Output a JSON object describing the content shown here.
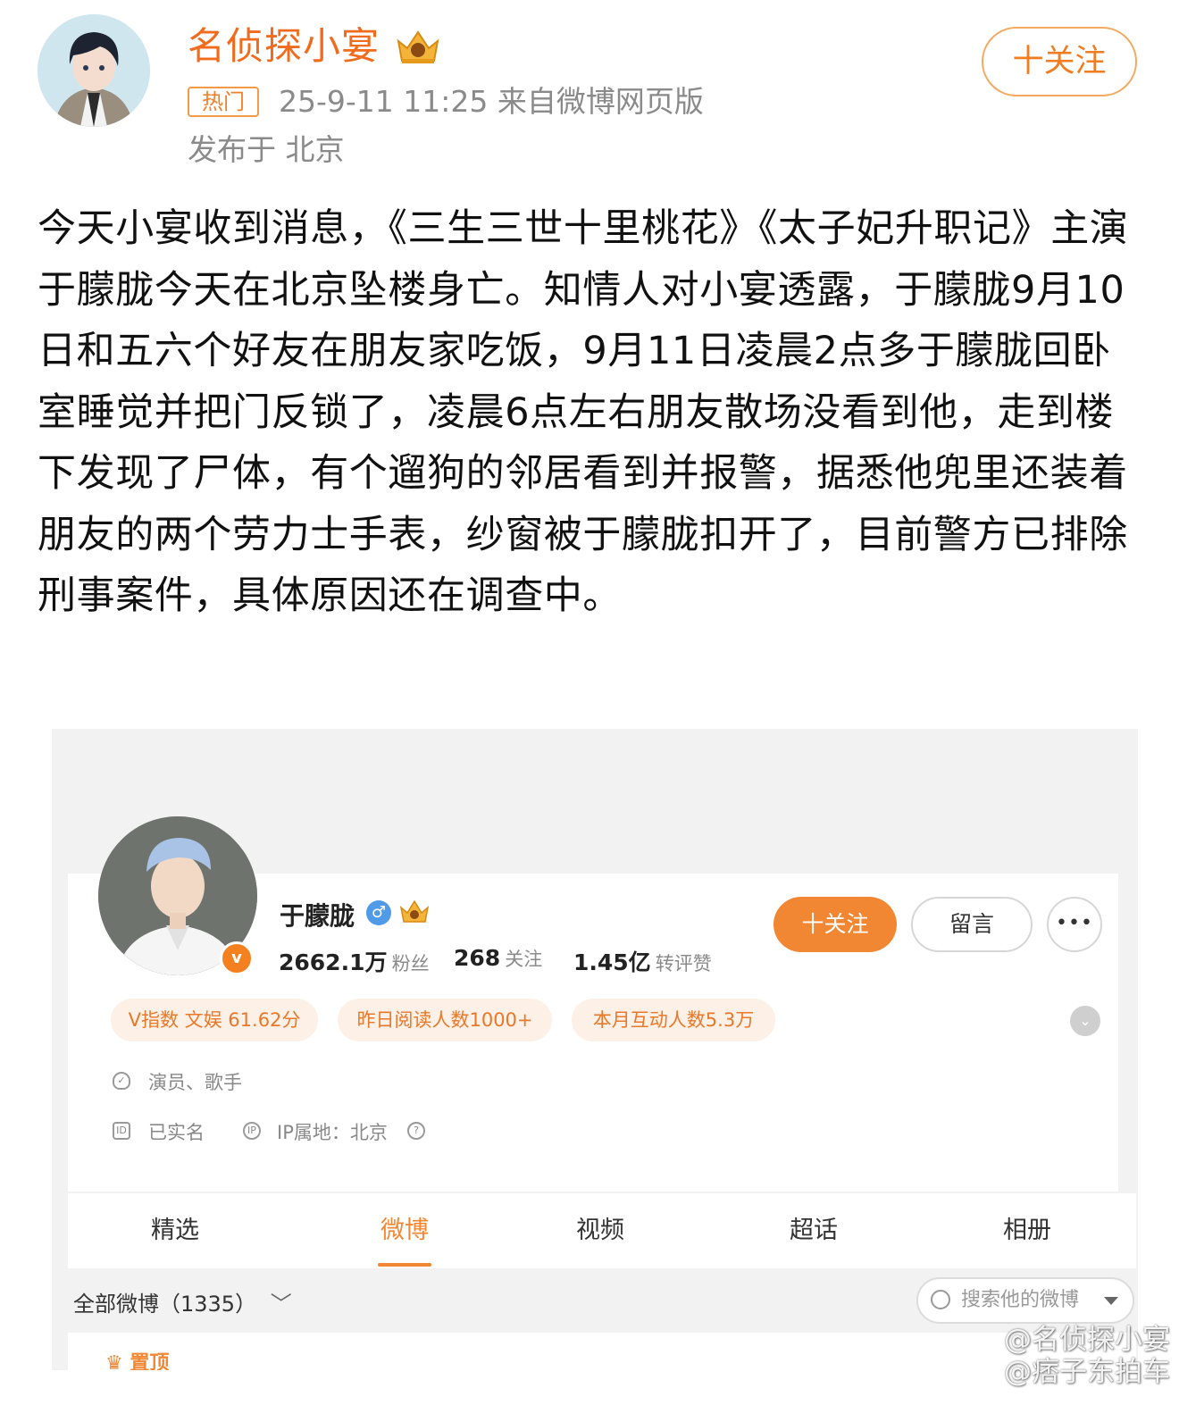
{
  "post": {
    "author": "名侦探小宴",
    "hot_tag": "热门",
    "meta": "25-9-11 11:25  来自微博网页版",
    "location": "发布于 北京",
    "follow_label": "十关注",
    "text": "今天小宴收到消息，《三生三世十里桃花》《太子妃升职记》主演于朦胧今天在北京坠楼身亡。知情人对小宴透露，于朦胧9月10日和五六个好友在朋友家吃饭，9月11日凌晨2点多于朦胧回卧室睡觉并把门反锁了，凌晨6点左右朋友散场没看到他，走到楼下发现了尸体，有个遛狗的邻居看到并报警，据悉他兜里还装着朋友的两个劳力士手表，纱窗被于朦胧扣开了，目前警方已排除刑事案件，具体原因还在调查中。"
  },
  "profile": {
    "name": "于朦胧",
    "gender_icon": "♂",
    "verified_badge": "v",
    "stats": [
      {
        "num": "2662.1万",
        "label": "粉丝"
      },
      {
        "num": "268",
        "label": "关注"
      },
      {
        "num": "1.45亿",
        "label": "转评赞"
      }
    ],
    "follow_label": "十关注",
    "message_label": "留言",
    "more_label": "•••",
    "pills": [
      "V指数 文娱 61.62分",
      "昨日阅读人数1000+",
      "本月互动人数5.3万"
    ],
    "occupation": "演员、歌手",
    "real_name": "已实名",
    "ip": "IP属地：北京",
    "tabs": [
      "精选",
      "微博",
      "视频",
      "超话",
      "相册"
    ],
    "active_tab": "微博",
    "filter": "全部微博（1335）",
    "search_placeholder": "搜索他的微博",
    "pinned": "置顶"
  },
  "watermark": {
    "line1": "@名侦探小宴",
    "line2": "@痞子东拍车"
  },
  "colors": {
    "brand_orange": "#f28733",
    "name_orange": "#f06b1c",
    "meta_gray": "#8a8a8a"
  },
  "icons": [
    "crown-badge-icon",
    "gender-male-icon",
    "verified-v-icon",
    "shield-icon",
    "id-card-icon",
    "ip-icon",
    "help-icon",
    "chevron-down-icon",
    "search-icon",
    "crown-icon"
  ]
}
